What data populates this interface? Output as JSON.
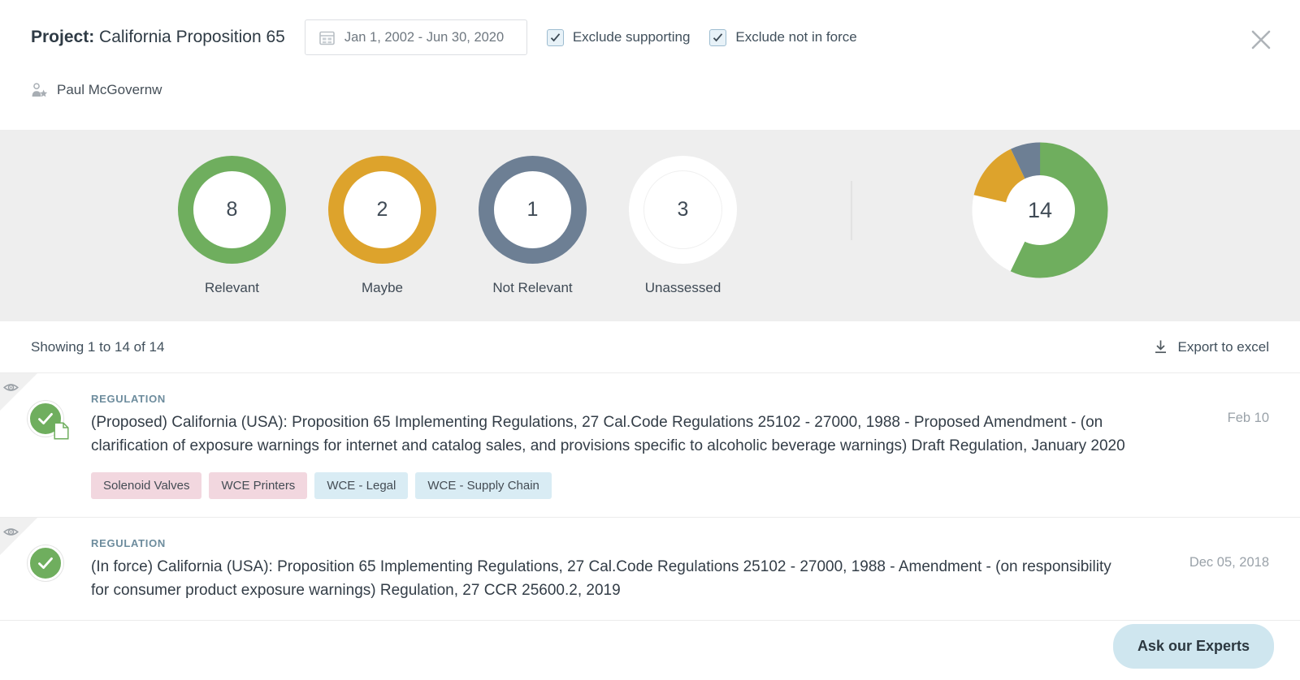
{
  "header": {
    "project_label": "Project:",
    "project_name": "California Proposition 65",
    "date_range": "Jan 1, 2002 - Jun 30, 2020",
    "calendar_icon": "calendar-icon",
    "close_icon": "close-icon",
    "checkboxes": [
      {
        "label": "Exclude supporting",
        "checked": true
      },
      {
        "label": "Exclude not in force",
        "checked": true
      }
    ],
    "user": {
      "name": "Paul McGovernw",
      "icon": "user-star-icon"
    }
  },
  "stats": {
    "rings": [
      {
        "label": "Relevant",
        "value": "8",
        "color": "#6fae5e"
      },
      {
        "label": "Maybe",
        "value": "2",
        "color": "#dda32c"
      },
      {
        "label": "Not Relevant",
        "value": "1",
        "color": "#6d7f94"
      },
      {
        "label": "Unassessed",
        "value": "3",
        "color": "#ffffff"
      }
    ],
    "donut_total": "14"
  },
  "chart_data": {
    "type": "pie",
    "title": "",
    "categories": [
      "Relevant",
      "Maybe",
      "Not Relevant",
      "Unassessed"
    ],
    "values": [
      8,
      2,
      1,
      3
    ],
    "colors": [
      "#6fae5e",
      "#dda32c",
      "#6d7f94",
      "#ffffff"
    ],
    "total": 14,
    "center_label": "14",
    "legend": "none",
    "donut": true
  },
  "results": {
    "showing": "Showing 1 to 14 of 14",
    "export_label": "Export to excel",
    "export_icon": "download-icon"
  },
  "items": [
    {
      "kicker": "REGULATION",
      "title": "(Proposed) California (USA): Proposition 65 Implementing Regulations, 27 Cal.Code Regulations 25102 - 27000, 1988 - Proposed Amendment - (on clarification of exposure warnings for internet and catalog sales, and provisions specific to alcoholic beverage warnings) Draft Regulation, January 2020",
      "date": "Feb 10",
      "status": "relevant",
      "has_document_badge": true,
      "tags": [
        {
          "label": "Solenoid Valves",
          "color": "pink"
        },
        {
          "label": "WCE Printers",
          "color": "pink"
        },
        {
          "label": "WCE - Legal",
          "color": "blue"
        },
        {
          "label": "WCE - Supply Chain",
          "color": "blue"
        }
      ]
    },
    {
      "kicker": "REGULATION",
      "title": "(In force) California (USA): Proposition 65 Implementing Regulations, 27 Cal.Code Regulations 25102 - 27000, 1988 - Amendment - (on responsibility for consumer product exposure warnings) Regulation, 27 CCR 25600.2, 2019",
      "date": "Dec 05, 2018",
      "status": "relevant",
      "has_document_badge": false,
      "tags": []
    }
  ],
  "floating": {
    "ask_experts": "Ask our Experts"
  }
}
